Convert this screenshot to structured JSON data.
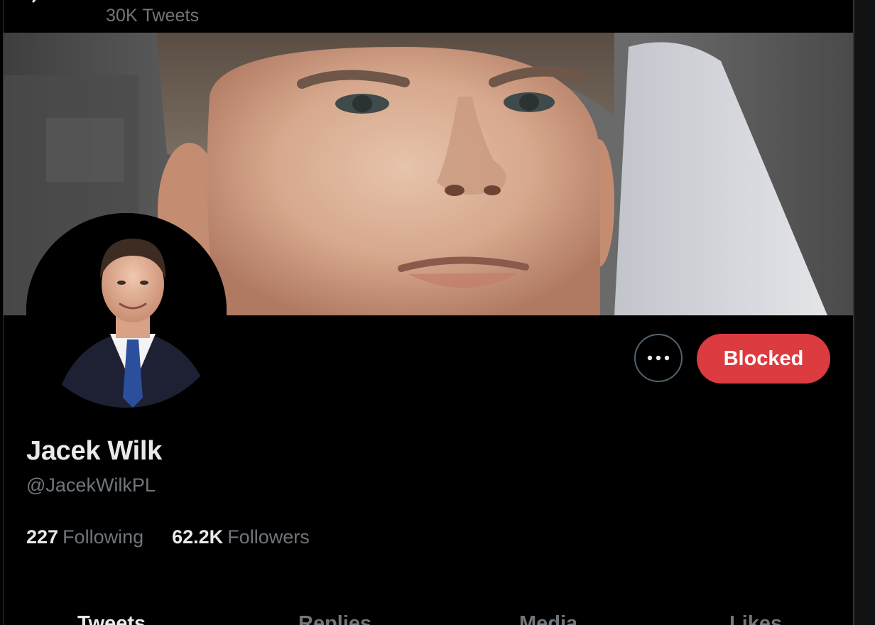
{
  "header": {
    "tweet_count": "30K Tweets"
  },
  "profile": {
    "display_name": "Jacek Wilk",
    "handle": "@JacekWilkPL",
    "following_count": "227",
    "following_label": "Following",
    "followers_count": "62.2K",
    "followers_label": "Followers"
  },
  "actions": {
    "blocked_label": "Blocked",
    "more_icon": "more-horizontal-icon"
  },
  "tabs": [
    {
      "label": "Tweets"
    },
    {
      "label": "Replies"
    },
    {
      "label": "Media"
    },
    {
      "label": "Likes"
    }
  ],
  "colors": {
    "background": "#000000",
    "primary_text": "#e7e9ea",
    "secondary_text": "#71767b",
    "blocked_red": "#dc3b3f",
    "border": "#2f3336"
  }
}
